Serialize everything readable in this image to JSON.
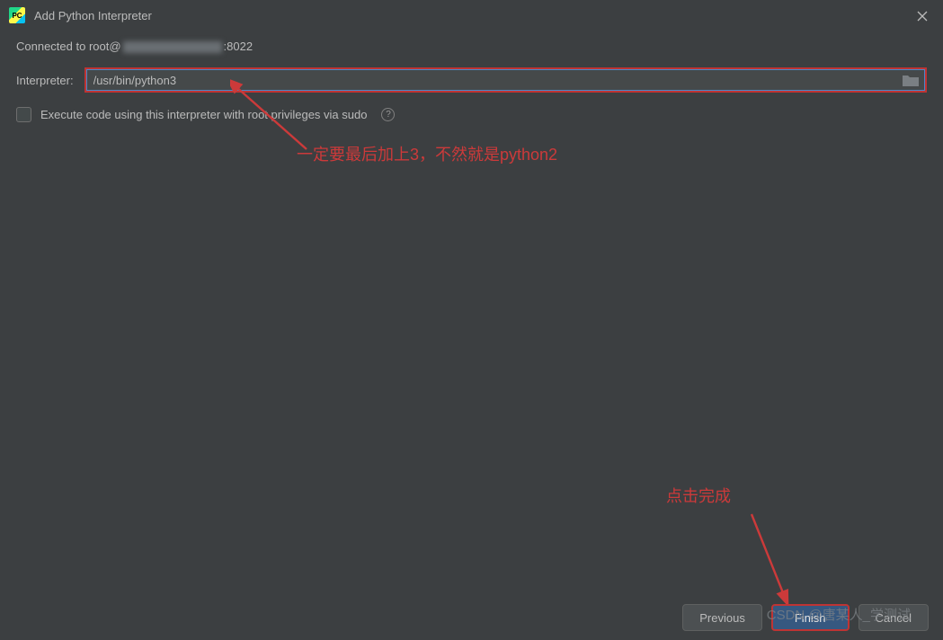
{
  "title": "Add Python Interpreter",
  "connected_prefix": "Connected to root@",
  "connected_suffix": ":8022",
  "interpreter_label": "Interpreter:",
  "interpreter_value": "/usr/bin/python3",
  "sudo_checkbox_label": "Execute code using this interpreter with root privileges via sudo",
  "annotation1": "一定要最后加上3，不然就是python2",
  "annotation2": "点击完成",
  "buttons": {
    "previous": "Previous",
    "finish": "Finish",
    "cancel": "Cancel"
  },
  "watermark": "CSDN @唐某人_学测试",
  "app_icon_text": "PC"
}
